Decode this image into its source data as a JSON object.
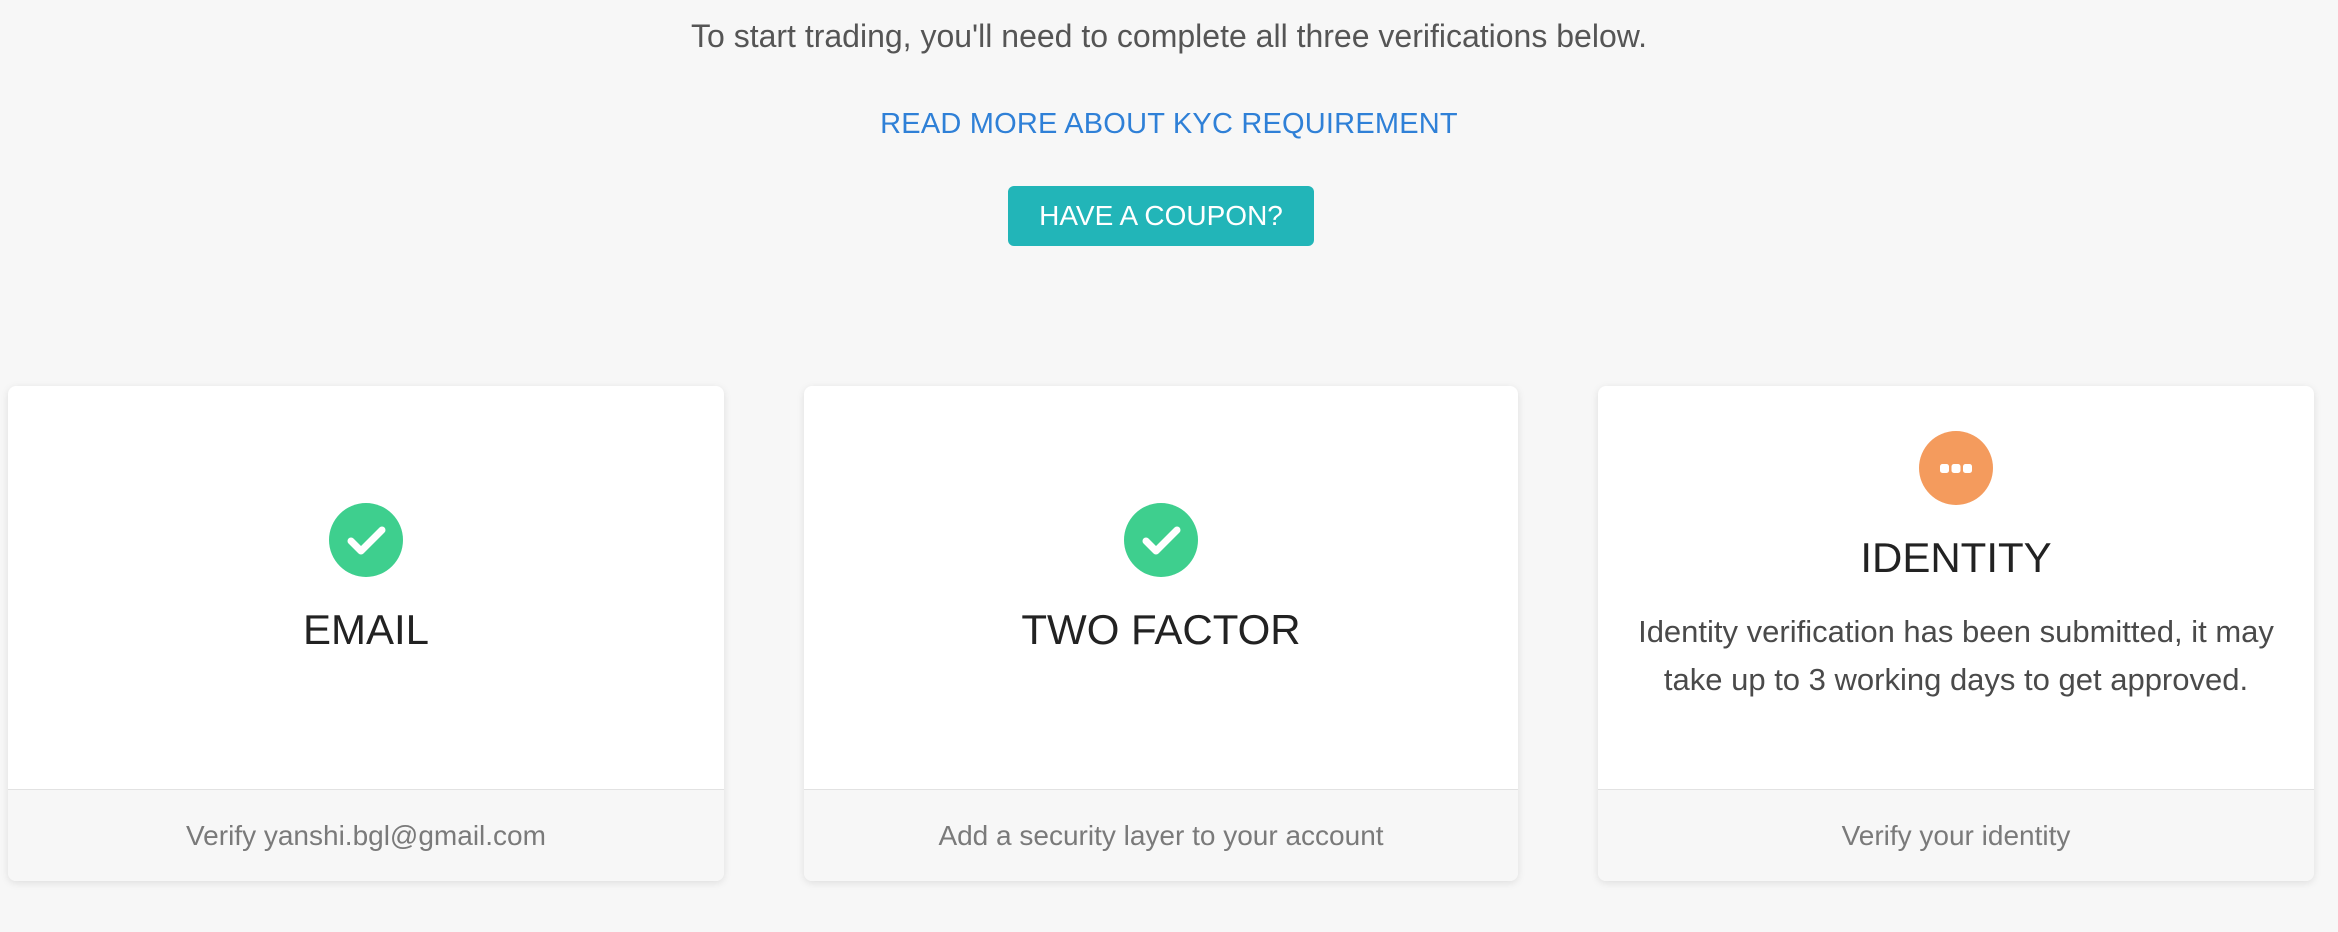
{
  "header": {
    "intro_text": "To start trading, you'll need to complete all three verifications below.",
    "kyc_link": "READ MORE ABOUT KYC REQUIREMENT",
    "coupon_button": "HAVE A COUPON?"
  },
  "cards": [
    {
      "title": "EMAIL",
      "status": "complete",
      "icon": "check-circle-icon",
      "footer": "Verify yanshi.bgl@gmail.com"
    },
    {
      "title": "TWO FACTOR",
      "status": "complete",
      "icon": "check-circle-icon",
      "footer": "Add a security layer to your account"
    },
    {
      "title": "IDENTITY",
      "status": "pending",
      "icon": "ellipsis-circle-icon",
      "description": "Identity verification has been submitted, it may take up to 3 working days to get approved.",
      "footer": "Verify your identity"
    }
  ],
  "colors": {
    "background": "#f7f7f7",
    "link": "#2f80d7",
    "coupon_button": "#22b5b8",
    "complete": "#3ecf8e",
    "pending": "#f49b5d"
  }
}
